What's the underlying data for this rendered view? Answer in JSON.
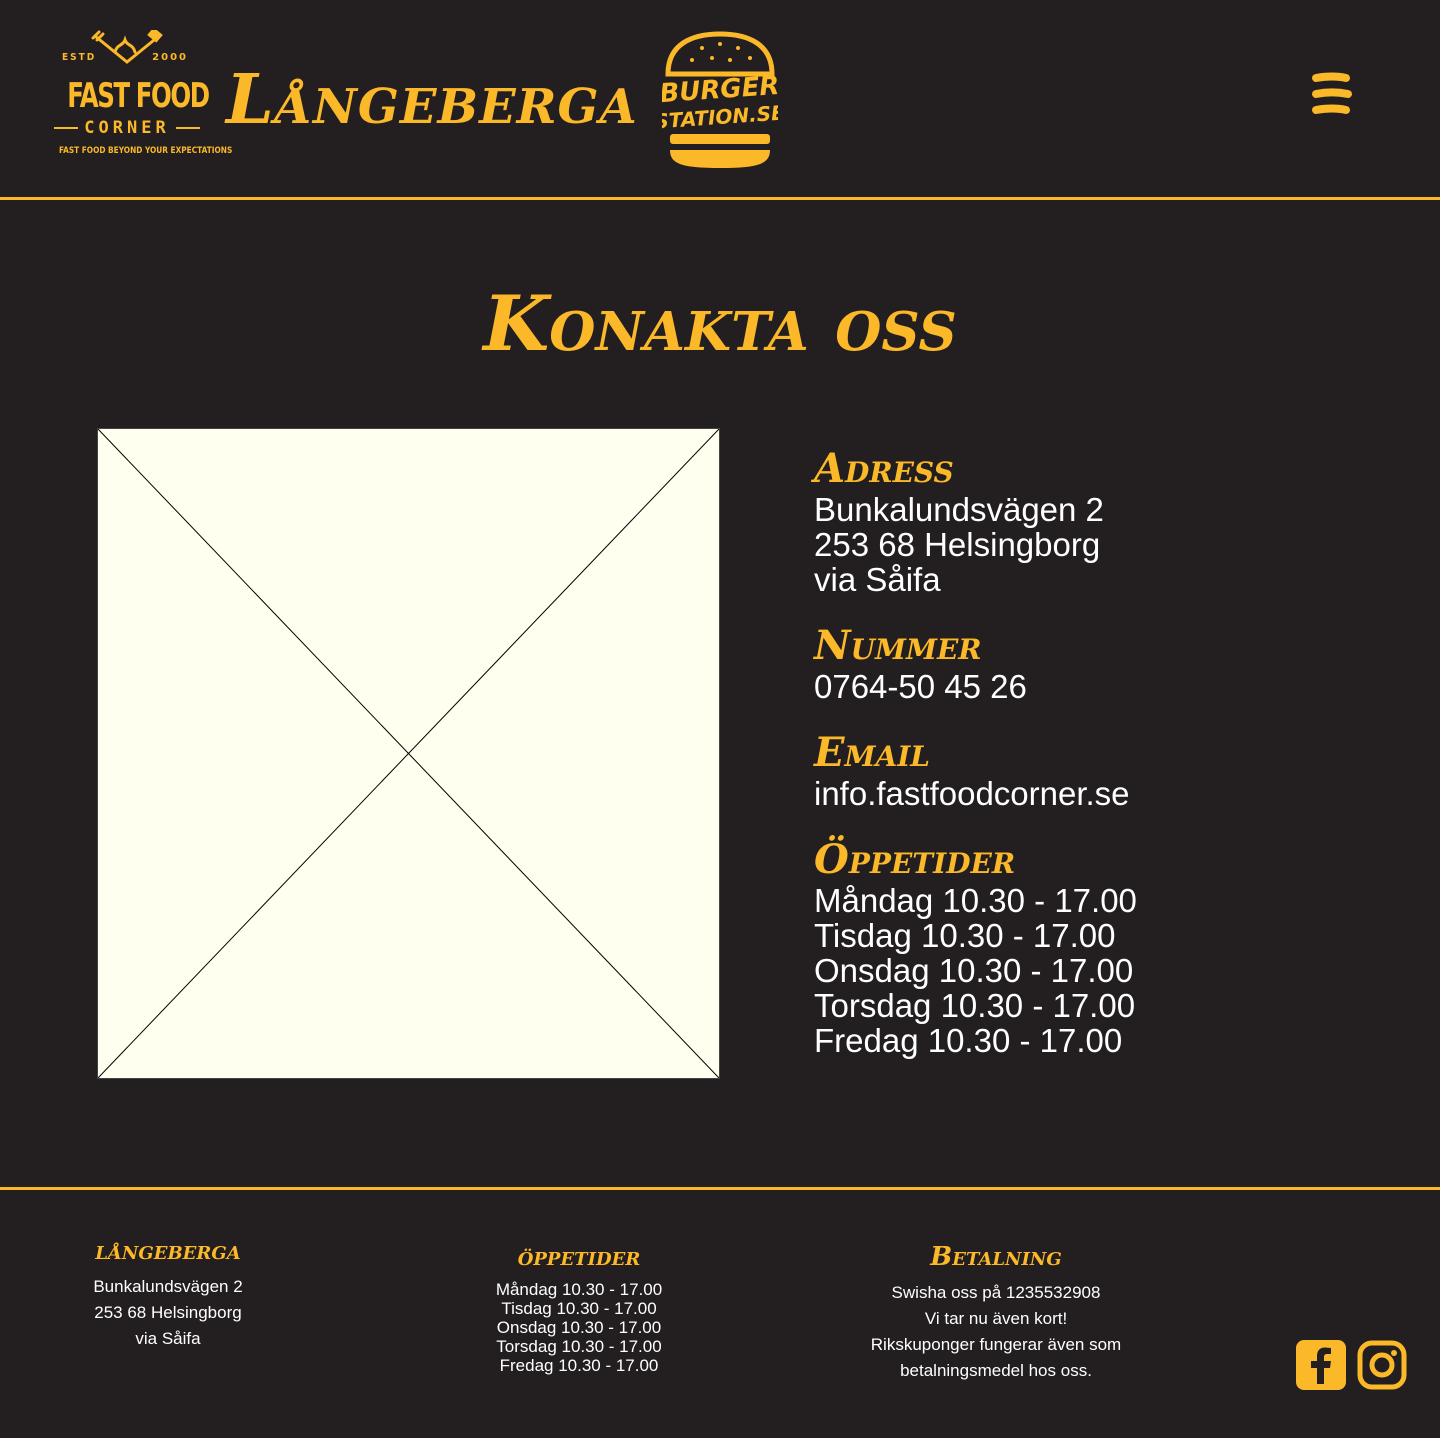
{
  "brand": {
    "logo_estd": "ESTD",
    "logo_year": "2000",
    "logo_main": "FAST FOOD",
    "logo_sub": "CORNER",
    "logo_tagline": "FAST FOOD BEYOND YOUR EXPECTATIONS",
    "site_title": "Långeberga",
    "burger_logo_line1": "BURGER",
    "burger_logo_line2": "STATION.SE",
    "accent_color": "#fbb829",
    "background_color": "#231f20"
  },
  "main": {
    "heading": "Konakta oss",
    "address_heading": "Adress",
    "address_lines": [
      "Bunkalundsvägen 2",
      "253 68 Helsingborg",
      "via Såifa"
    ],
    "phone_heading": "Nummer",
    "phone": "0764-50 45 26",
    "email_heading": "Email",
    "email": "info.fastfoodcorner.se",
    "hours_heading": "Öppetider",
    "hours": [
      "Måndag 10.30 - 17.00",
      "Tisdag 10.30 - 17.00",
      "Onsdag 10.30 - 17.00",
      "Torsdag 10.30 - 17.00",
      "Fredag 10.30 - 17.00"
    ]
  },
  "footer": {
    "addr_heading": "långeberga",
    "addr_lines": [
      "Bunkalundsvägen 2",
      "253 68 Helsingborg",
      "via Såifa"
    ],
    "hours_heading": "öppetider",
    "hours": [
      "Måndag 10.30 - 17.00",
      "Tisdag 10.30 - 17.00",
      "Onsdag 10.30 - 17.00",
      "Torsdag 10.30 - 17.00",
      "Fredag 10.30 - 17.00"
    ],
    "pay_heading": "Betalning",
    "pay_lines": [
      "Swisha oss på 1235532908",
      "Vi tar nu även kort!",
      "Rikskuponger fungerar även som",
      "betalningsmedel hos oss."
    ],
    "social_icons": [
      "facebook-icon",
      "instagram-icon"
    ]
  }
}
